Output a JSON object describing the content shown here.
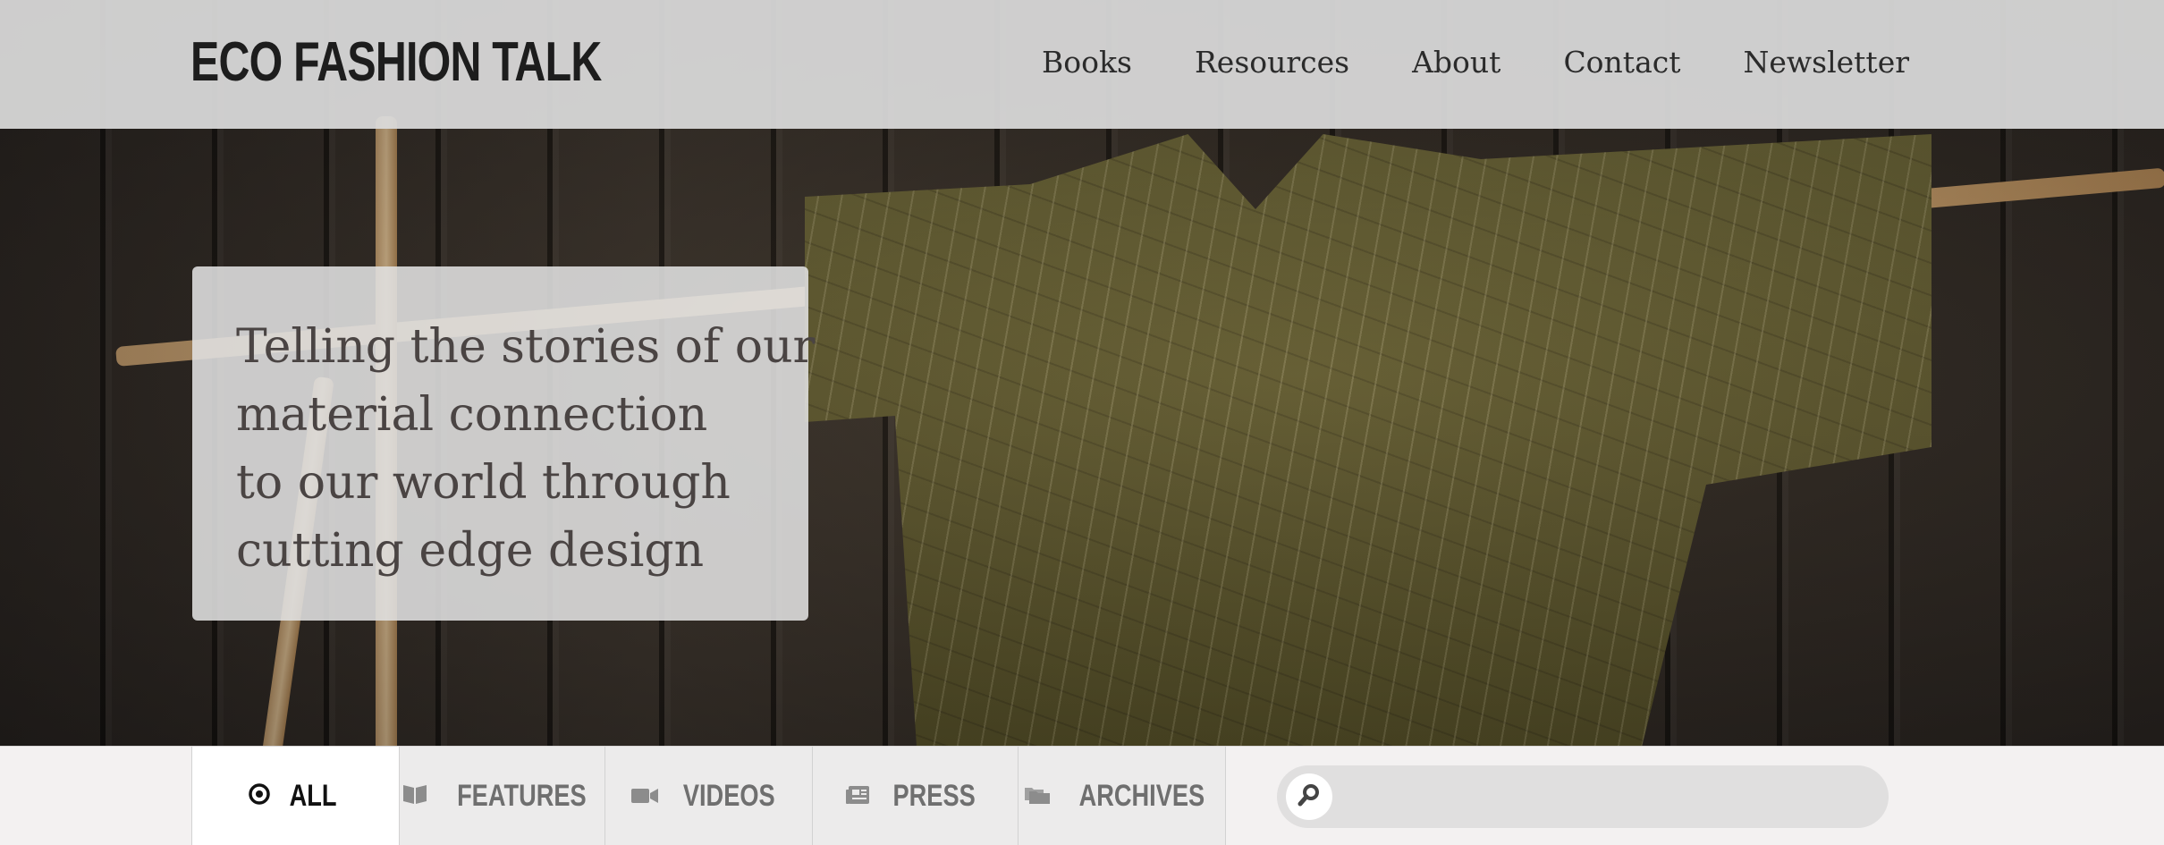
{
  "site": {
    "title": "ECO FASHION TALK"
  },
  "nav": {
    "items": [
      {
        "label": "Books"
      },
      {
        "label": "Resources"
      },
      {
        "label": "About"
      },
      {
        "label": "Contact"
      },
      {
        "label": "Newsletter"
      }
    ]
  },
  "hero": {
    "tagline_lines": [
      "Telling the stories of our",
      "material connection",
      "to our world through",
      "cutting edge design"
    ]
  },
  "filters": {
    "tabs": [
      {
        "label": "ALL",
        "icon": "target-icon",
        "active": true
      },
      {
        "label": "FEATURES",
        "icon": "book-icon",
        "active": false
      },
      {
        "label": "VIDEOS",
        "icon": "video-camera-icon",
        "active": false
      },
      {
        "label": "PRESS",
        "icon": "newspaper-icon",
        "active": false
      },
      {
        "label": "ARCHIVES",
        "icon": "folders-icon",
        "active": false
      }
    ],
    "search": {
      "placeholder": "",
      "value": "",
      "icon": "search-icon"
    }
  },
  "colors": {
    "header_bg": "#dcdcdc",
    "text_dark": "#2b2b2b",
    "tagline_text": "#4a4443",
    "tab_active": "#111111",
    "tab_inactive": "#6f6f6f"
  }
}
